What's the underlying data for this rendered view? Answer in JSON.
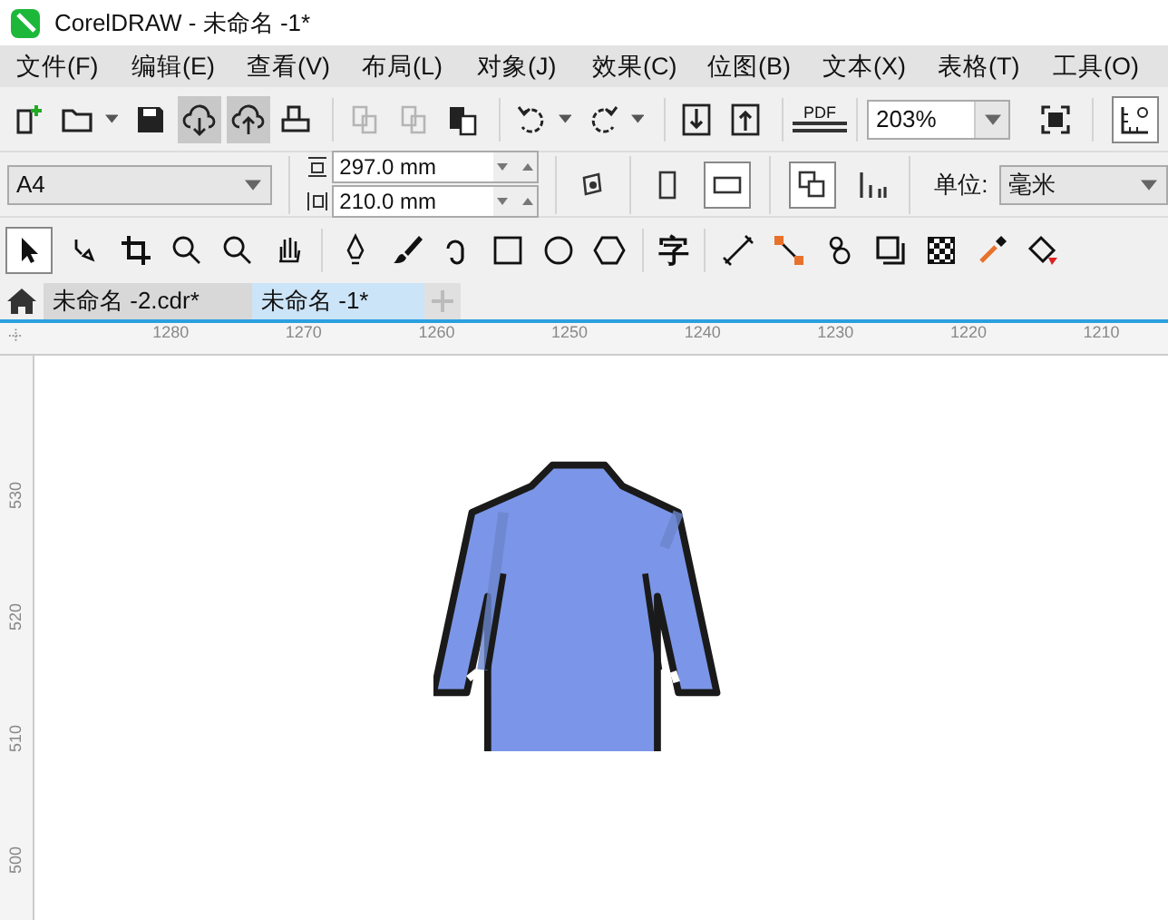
{
  "window": {
    "title": "CorelDRAW - 未命名 -1*"
  },
  "menu": [
    "文件(F)",
    "编辑(E)",
    "查看(V)",
    "布局(L)",
    "对象(J)",
    "效果(C)",
    "位图(B)",
    "文本(X)",
    "表格(T)",
    "工具(O)"
  ],
  "toolbar": {
    "buttons": [
      {
        "pressed": false,
        "disabled": false
      },
      {
        "pressed": false,
        "disabled": false
      },
      {
        "pressed": false,
        "disabled": false
      },
      {
        "pressed": true,
        "disabled": false
      },
      {
        "pressed": true,
        "disabled": false
      },
      {
        "pressed": false,
        "disabled": false
      },
      {
        "pressed": false,
        "disabled": true
      },
      {
        "pressed": false,
        "disabled": true
      },
      {
        "pressed": false,
        "disabled": false
      },
      {
        "pressed": false,
        "disabled": false
      },
      {
        "pressed": false,
        "disabled": false
      },
      {
        "pressed": false,
        "disabled": false
      },
      {
        "pressed": false,
        "disabled": false
      }
    ],
    "pdf_label": "PDF",
    "zoom": "203%"
  },
  "property_bar": {
    "page_size": "A4",
    "height": "297.0 mm",
    "width": "210.0 mm",
    "unit_label": "单位:",
    "unit": "毫米"
  },
  "toolbox": {
    "text_tool": "字"
  },
  "tabs": [
    {
      "label": "未命名 -2.cdr*",
      "selected": false
    },
    {
      "label": "未命名 -1*",
      "selected": true
    }
  ],
  "ruler": {
    "horizontal": [
      "1280",
      "1270",
      "1260",
      "1250",
      "1240",
      "1230",
      "1220",
      "1210"
    ],
    "vertical": [
      "530",
      "520",
      "510",
      "500"
    ]
  }
}
